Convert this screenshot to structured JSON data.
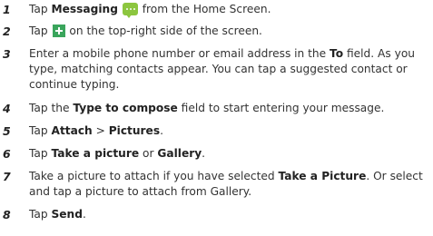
{
  "steps": [
    {
      "num": "1",
      "a": "Tap ",
      "b": "Messaging",
      "c": " from the Home Screen."
    },
    {
      "num": "2",
      "a": "Tap ",
      "b": " on the top-right side of the screen."
    },
    {
      "num": "3",
      "a": "Enter a mobile phone number or email address in the ",
      "b": "To",
      "c": " field. As you type, matching contacts appear. You can tap a suggested contact or continue typing."
    },
    {
      "num": "4",
      "a": "Tap the ",
      "b": "Type to compose",
      "c": " field to start entering your message."
    },
    {
      "num": "5",
      "a": "Tap ",
      "b": "Attach",
      "c": " > ",
      "d": "Pictures",
      "e": "."
    },
    {
      "num": "6",
      "a": "Tap ",
      "b": "Take a picture",
      "c": " or ",
      "d": "Gallery",
      "e": "."
    },
    {
      "num": "7",
      "a": "Take a picture to attach if you have selected ",
      "b": "Take a Picture",
      "c": ". Or select and tap a picture to attach from Gallery."
    },
    {
      "num": "8",
      "a": "Tap ",
      "b": "Send",
      "c": "."
    }
  ],
  "icons": {
    "messaging": "messaging-icon",
    "add": "add-plus-icon"
  }
}
